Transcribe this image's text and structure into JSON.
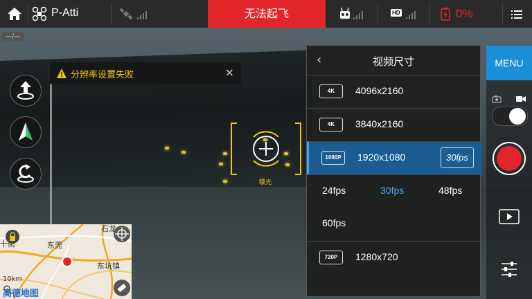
{
  "topbar": {
    "flight_mode": "P-Atti",
    "alert": "无法起飞",
    "hd_label": "HD",
    "battery_percent": "0%"
  },
  "scale_pill": "—/—",
  "warning": {
    "text": "分辨率设置失败",
    "close": "×"
  },
  "focus": {
    "exposure_label": "曝光"
  },
  "panel": {
    "back": "‹",
    "title": "视频尺寸",
    "rows": [
      {
        "badge": "4K",
        "resolution": "4096x2160"
      },
      {
        "badge": "4K",
        "resolution": "3840x2160"
      },
      {
        "badge": "1080P",
        "resolution": "1920x1080",
        "fps": "30fps",
        "selected": true
      },
      {
        "badge": "720P",
        "resolution": "1280x720"
      }
    ],
    "fps_options": [
      "24fps",
      "30fps",
      "48fps",
      "60fps"
    ],
    "selected_fps": "30fps"
  },
  "right": {
    "menu": "MENU"
  },
  "map": {
    "labels": {
      "shilong": "石龙",
      "dongguan": "东莞",
      "dongkeng": "东坑镇",
      "shijie": "十街",
      "scale": "10km",
      "brand": "高德地图"
    }
  },
  "colors": {
    "alert_red": "#e1262b",
    "accent_blue": "#1a8fd8",
    "warning_yellow": "#f1c40f",
    "selected_row": "#1b5d93"
  }
}
